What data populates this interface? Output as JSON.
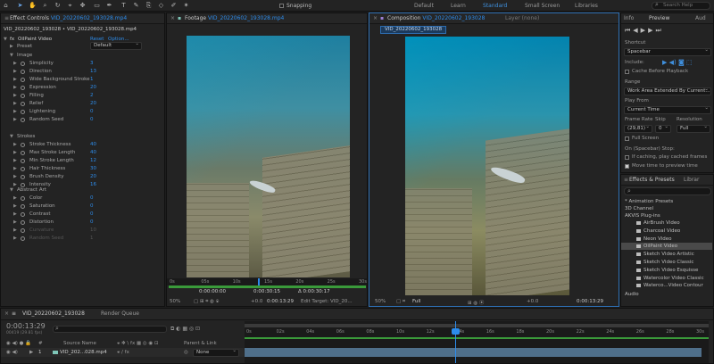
{
  "toolbar": {
    "snapping": "Snapping",
    "workspaces": [
      "Default",
      "Learn",
      "Standard",
      "Small Screen",
      "Libraries"
    ],
    "active_workspace": "Standard",
    "search_placeholder": "Search Help"
  },
  "effect_controls": {
    "tab_label": "Effect Controls",
    "tab_file": "VID_20220602_193028.mp4",
    "layer_path": "VID_20220602_193028 • VID_20220602_193028.mp4",
    "effect_name": "OilPaint Video",
    "reset": "Reset",
    "options": "Option...",
    "preset_label": "Preset",
    "preset_value": "Default",
    "groups": {
      "image": "Image",
      "strokes": "Strokes",
      "abstract": "Abstract Art"
    },
    "image_params": [
      {
        "name": "Simplicity",
        "value": "3"
      },
      {
        "name": "Direction",
        "value": "13"
      },
      {
        "name": "Wide Background Stroke",
        "value": "1"
      },
      {
        "name": "Expression",
        "value": "20"
      },
      {
        "name": "Filling",
        "value": "2"
      },
      {
        "name": "Relief",
        "value": "20"
      },
      {
        "name": "Lightening",
        "value": "0"
      },
      {
        "name": "Random Seed",
        "value": "0"
      }
    ],
    "stroke_params": [
      {
        "name": "Stroke Thickness",
        "value": "40"
      },
      {
        "name": "Max Stroke Length",
        "value": "40"
      },
      {
        "name": "Min Stroke Length",
        "value": "12"
      },
      {
        "name": "Hair Thickness",
        "value": "30"
      },
      {
        "name": "Brush Density",
        "value": "20"
      },
      {
        "name": "Intensity",
        "value": "16"
      }
    ],
    "abstract_params": [
      {
        "name": "Color",
        "value": "0"
      },
      {
        "name": "Saturation",
        "value": "0"
      },
      {
        "name": "Contrast",
        "value": "0"
      },
      {
        "name": "Distortion",
        "value": "0"
      }
    ],
    "disabled_params": [
      {
        "name": "Curvature",
        "value": "10"
      },
      {
        "name": "Random Seed",
        "value": "1"
      }
    ]
  },
  "footage": {
    "tab_label": "Footage",
    "tab_file": "VID_20220602_193028.mp4",
    "ruler": [
      "0s",
      "05s",
      "10s",
      "15s",
      "20s",
      "25s",
      "30s"
    ],
    "in_point": "0:00:00:00",
    "out_point": "0:00:30:15",
    "duration": "Δ 0:00:30:17",
    "zoom": "50%",
    "timecode": "0:00:13:29",
    "offset": "+0.0",
    "edit_target": "Edit Target: VID_20..."
  },
  "composition": {
    "tab_label": "Composition",
    "tab_name": "VID_20220602_193028",
    "layer_tab": "Layer (none)",
    "crumb": "VID_20220602_193028",
    "zoom": "50%",
    "quality": "Full",
    "offset": "+0.0",
    "timecode": "0:00:13:29"
  },
  "preview": {
    "tabs": [
      "Info",
      "Preview",
      "Aud"
    ],
    "shortcut_label": "Shortcut",
    "shortcut_value": "Spacebar",
    "include_label": "Include:",
    "cache_before": "Cache Before Playback",
    "range_label": "Range",
    "range_value": "Work Area Extended By Current...",
    "play_from_label": "Play From",
    "play_from_value": "Current Time",
    "frame_rate_label": "Frame Rate",
    "skip_label": "Skip",
    "resolution_label": "Resolution",
    "frame_rate_value": "(29,81)",
    "skip_value": "0",
    "resolution_value": "Full",
    "full_screen": "Full Screen",
    "on_stop": "On (Spacebar) Stop:",
    "if_caching": "If caching, play cached frames",
    "move_time": "Move time to preview time"
  },
  "effects_presets": {
    "tabs": [
      "Effects & Presets",
      "Librar"
    ],
    "search_placeholder": "",
    "categories": [
      "* Animation Presets",
      "3D Channel",
      "AKVIS Plug-ins"
    ],
    "effects": [
      "AirBrush Video",
      "Charcoal Video",
      "Neon Video",
      "OilPaint Video",
      "Sketch Video Artistic",
      "Sketch Video Classic",
      "Sketch Video Esquisse",
      "Watercolor Video Classic",
      "Waterco...Video Contour"
    ],
    "selected_effect": "OilPaint Video",
    "last_category": "Audio"
  },
  "timeline": {
    "tab_label": "VID_20220602_193028",
    "render_queue": "Render Queue",
    "timecode": "0:00:13:29",
    "frame_info": "00419 (29.81 fps)",
    "search_placeholder": "",
    "col_source": "Source Name",
    "col_parent": "Parent & Link",
    "layer_number": "1",
    "layer_name": "VID_202...028.mp4",
    "parent_value": "None",
    "ruler": [
      "0s",
      "02s",
      "04s",
      "06s",
      "08s",
      "10s",
      "12s",
      "14s",
      "16s",
      "18s",
      "20s",
      "22s",
      "24s",
      "26s",
      "28s",
      "30s"
    ]
  },
  "colors": {
    "accent": "#2d8ceb",
    "panel": "#232323",
    "bar_green": "#3a9a3a",
    "bar_blue": "#3c78c8",
    "layer_bar": "#4f6f8a"
  }
}
